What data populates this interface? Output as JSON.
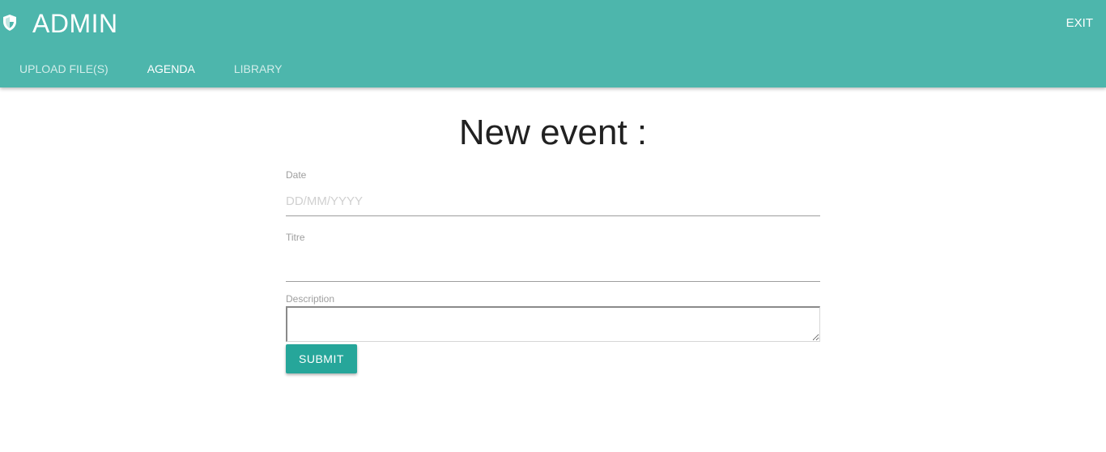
{
  "header": {
    "brand_icon": "shield-icon",
    "title": "ADMIN",
    "exit_label": "EXIT",
    "background_color": "#4db6ac"
  },
  "tabs": [
    {
      "label": "UPLOAD FILE(S)",
      "active": false
    },
    {
      "label": "AGENDA",
      "active": true
    },
    {
      "label": "LIBRARY",
      "active": false
    }
  ],
  "main": {
    "heading": "New event :"
  },
  "form": {
    "date": {
      "label": "Date",
      "value": "",
      "placeholder": "DD/MM/YYYY"
    },
    "title": {
      "label": "Titre",
      "value": "",
      "placeholder": ""
    },
    "description": {
      "label": "Description",
      "value": ""
    },
    "submit_label": "SUBMIT",
    "submit_color": "#26a69a"
  }
}
